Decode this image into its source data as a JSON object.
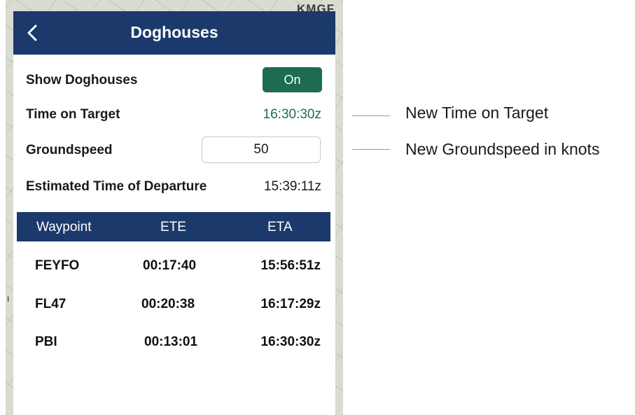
{
  "map": {
    "airport_label": "KMGF"
  },
  "header": {
    "title": "Doghouses",
    "back_icon": "chevron-left-icon"
  },
  "settings": {
    "show_doghouses": {
      "label": "Show Doghouses",
      "toggle_value": "On"
    },
    "time_on_target": {
      "label": "Time on Target",
      "value": "16:30:30z"
    },
    "groundspeed": {
      "label": "Groundspeed",
      "value": "50"
    },
    "etd": {
      "label": "Estimated Time of Departure",
      "value": "15:39:11z"
    }
  },
  "table": {
    "headers": [
      "Waypoint",
      "ETE",
      "ETA"
    ],
    "rows": [
      {
        "waypoint": "FEYFO",
        "ete": "00:17:40",
        "eta": "15:56:51z"
      },
      {
        "waypoint": "FL47",
        "ete": "00:20:38",
        "eta": "16:17:29z"
      },
      {
        "waypoint": "PBI",
        "ete": "00:13:01",
        "eta": "16:30:30z"
      }
    ]
  },
  "callouts": {
    "time_on_target": "New Time on Target",
    "groundspeed": "New Groundspeed in knots"
  },
  "colors": {
    "header_bg": "#1b3a6b",
    "toggle_on": "#1e6b53",
    "accent_text": "#1e6b53"
  }
}
